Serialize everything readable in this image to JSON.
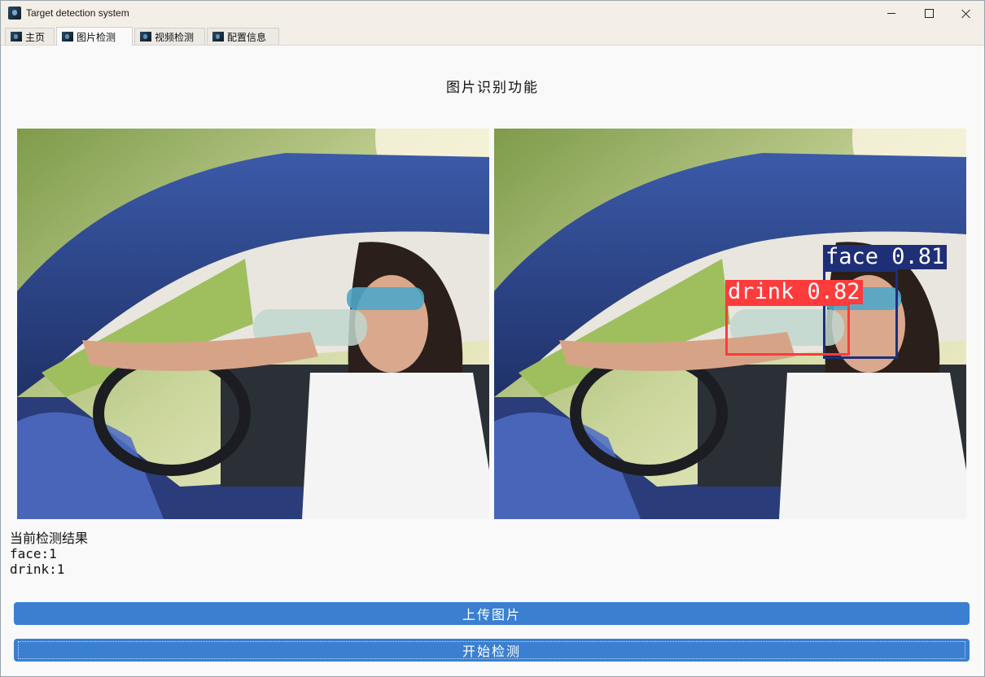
{
  "window": {
    "title": "Target detection system"
  },
  "tabs": [
    {
      "label": "主页",
      "icon": "app-icon"
    },
    {
      "label": "图片检测",
      "icon": "app-icon",
      "active": true
    },
    {
      "label": "视频检测",
      "icon": "app-icon"
    },
    {
      "label": "配置信息",
      "icon": "app-icon"
    }
  ],
  "main": {
    "heading": "图片识别功能",
    "detections": [
      {
        "label": "drink 0.82",
        "color": "#ff3b3b"
      },
      {
        "label": "face 0.81",
        "color": "#1e2f78"
      }
    ],
    "results": {
      "title": "当前检测结果",
      "lines": [
        "face:1",
        "drink:1"
      ]
    },
    "buttons": {
      "upload": "上传图片",
      "start": "开始检测"
    }
  },
  "colors": {
    "accent": "#3a7fd0",
    "drink_box": "#ff3b3b",
    "face_box": "#1e2f78"
  }
}
